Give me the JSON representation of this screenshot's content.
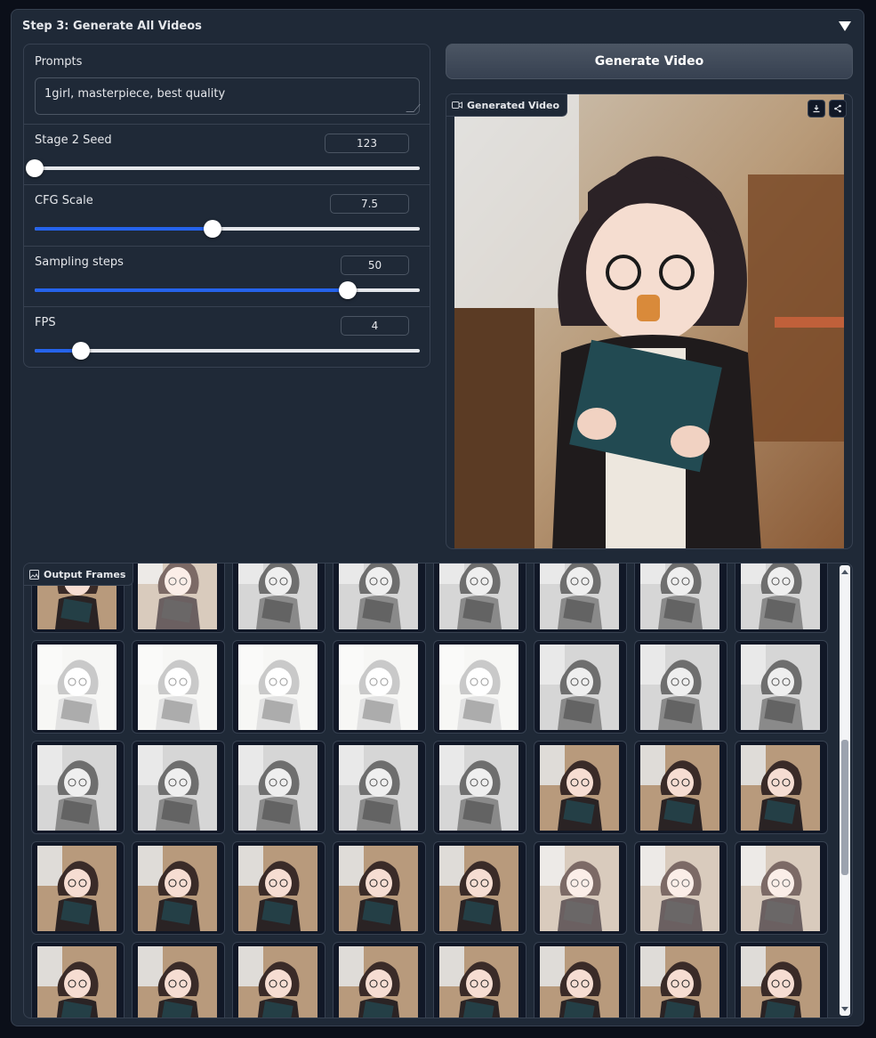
{
  "panel": {
    "title": "Step 3: Generate All Videos",
    "collapse_icon": "triangle-down-icon"
  },
  "prompts": {
    "label": "Prompts",
    "value": "1girl, masterpiece, best quality"
  },
  "sliders": [
    {
      "label": "Stage 2 Seed",
      "value": "123",
      "fraction": 0.0
    },
    {
      "label": "CFG Scale",
      "value": "7.5",
      "fraction": 0.463
    },
    {
      "label": "Sampling steps",
      "value": "50",
      "fraction": 0.813
    },
    {
      "label": "FPS",
      "value": "4",
      "fraction": 0.12
    }
  ],
  "generate_button": "Generate Video",
  "video": {
    "label": "Generated Video",
    "icon": "video-camera-icon",
    "download_icon": "download-icon",
    "share_icon": "share-icon"
  },
  "frames": {
    "label": "Output Frames",
    "icon": "image-icon"
  },
  "colors": {
    "accent": "#2563eb",
    "panel_bg": "#1f2937",
    "page_bg": "#0b0f19",
    "border": "#374151"
  }
}
